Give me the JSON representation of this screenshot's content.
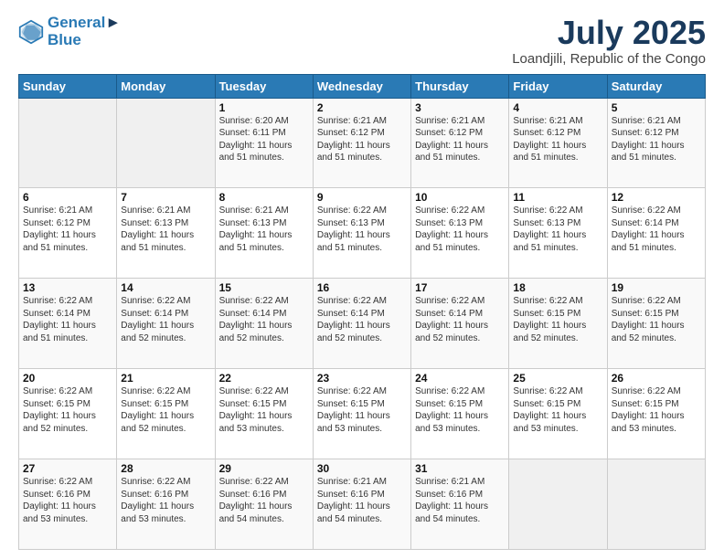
{
  "logo": {
    "line1": "General",
    "line2": "Blue"
  },
  "title": "July 2025",
  "subtitle": "Loandjili, Republic of the Congo",
  "days_of_week": [
    "Sunday",
    "Monday",
    "Tuesday",
    "Wednesday",
    "Thursday",
    "Friday",
    "Saturday"
  ],
  "weeks": [
    [
      {
        "day": "",
        "text": ""
      },
      {
        "day": "",
        "text": ""
      },
      {
        "day": "1",
        "text": "Sunrise: 6:20 AM\nSunset: 6:11 PM\nDaylight: 11 hours and 51 minutes."
      },
      {
        "day": "2",
        "text": "Sunrise: 6:21 AM\nSunset: 6:12 PM\nDaylight: 11 hours and 51 minutes."
      },
      {
        "day": "3",
        "text": "Sunrise: 6:21 AM\nSunset: 6:12 PM\nDaylight: 11 hours and 51 minutes."
      },
      {
        "day": "4",
        "text": "Sunrise: 6:21 AM\nSunset: 6:12 PM\nDaylight: 11 hours and 51 minutes."
      },
      {
        "day": "5",
        "text": "Sunrise: 6:21 AM\nSunset: 6:12 PM\nDaylight: 11 hours and 51 minutes."
      }
    ],
    [
      {
        "day": "6",
        "text": "Sunrise: 6:21 AM\nSunset: 6:12 PM\nDaylight: 11 hours and 51 minutes."
      },
      {
        "day": "7",
        "text": "Sunrise: 6:21 AM\nSunset: 6:13 PM\nDaylight: 11 hours and 51 minutes."
      },
      {
        "day": "8",
        "text": "Sunrise: 6:21 AM\nSunset: 6:13 PM\nDaylight: 11 hours and 51 minutes."
      },
      {
        "day": "9",
        "text": "Sunrise: 6:22 AM\nSunset: 6:13 PM\nDaylight: 11 hours and 51 minutes."
      },
      {
        "day": "10",
        "text": "Sunrise: 6:22 AM\nSunset: 6:13 PM\nDaylight: 11 hours and 51 minutes."
      },
      {
        "day": "11",
        "text": "Sunrise: 6:22 AM\nSunset: 6:13 PM\nDaylight: 11 hours and 51 minutes."
      },
      {
        "day": "12",
        "text": "Sunrise: 6:22 AM\nSunset: 6:14 PM\nDaylight: 11 hours and 51 minutes."
      }
    ],
    [
      {
        "day": "13",
        "text": "Sunrise: 6:22 AM\nSunset: 6:14 PM\nDaylight: 11 hours and 51 minutes."
      },
      {
        "day": "14",
        "text": "Sunrise: 6:22 AM\nSunset: 6:14 PM\nDaylight: 11 hours and 52 minutes."
      },
      {
        "day": "15",
        "text": "Sunrise: 6:22 AM\nSunset: 6:14 PM\nDaylight: 11 hours and 52 minutes."
      },
      {
        "day": "16",
        "text": "Sunrise: 6:22 AM\nSunset: 6:14 PM\nDaylight: 11 hours and 52 minutes."
      },
      {
        "day": "17",
        "text": "Sunrise: 6:22 AM\nSunset: 6:14 PM\nDaylight: 11 hours and 52 minutes."
      },
      {
        "day": "18",
        "text": "Sunrise: 6:22 AM\nSunset: 6:15 PM\nDaylight: 11 hours and 52 minutes."
      },
      {
        "day": "19",
        "text": "Sunrise: 6:22 AM\nSunset: 6:15 PM\nDaylight: 11 hours and 52 minutes."
      }
    ],
    [
      {
        "day": "20",
        "text": "Sunrise: 6:22 AM\nSunset: 6:15 PM\nDaylight: 11 hours and 52 minutes."
      },
      {
        "day": "21",
        "text": "Sunrise: 6:22 AM\nSunset: 6:15 PM\nDaylight: 11 hours and 52 minutes."
      },
      {
        "day": "22",
        "text": "Sunrise: 6:22 AM\nSunset: 6:15 PM\nDaylight: 11 hours and 53 minutes."
      },
      {
        "day": "23",
        "text": "Sunrise: 6:22 AM\nSunset: 6:15 PM\nDaylight: 11 hours and 53 minutes."
      },
      {
        "day": "24",
        "text": "Sunrise: 6:22 AM\nSunset: 6:15 PM\nDaylight: 11 hours and 53 minutes."
      },
      {
        "day": "25",
        "text": "Sunrise: 6:22 AM\nSunset: 6:15 PM\nDaylight: 11 hours and 53 minutes."
      },
      {
        "day": "26",
        "text": "Sunrise: 6:22 AM\nSunset: 6:15 PM\nDaylight: 11 hours and 53 minutes."
      }
    ],
    [
      {
        "day": "27",
        "text": "Sunrise: 6:22 AM\nSunset: 6:16 PM\nDaylight: 11 hours and 53 minutes."
      },
      {
        "day": "28",
        "text": "Sunrise: 6:22 AM\nSunset: 6:16 PM\nDaylight: 11 hours and 53 minutes."
      },
      {
        "day": "29",
        "text": "Sunrise: 6:22 AM\nSunset: 6:16 PM\nDaylight: 11 hours and 54 minutes."
      },
      {
        "day": "30",
        "text": "Sunrise: 6:21 AM\nSunset: 6:16 PM\nDaylight: 11 hours and 54 minutes."
      },
      {
        "day": "31",
        "text": "Sunrise: 6:21 AM\nSunset: 6:16 PM\nDaylight: 11 hours and 54 minutes."
      },
      {
        "day": "",
        "text": ""
      },
      {
        "day": "",
        "text": ""
      }
    ]
  ]
}
